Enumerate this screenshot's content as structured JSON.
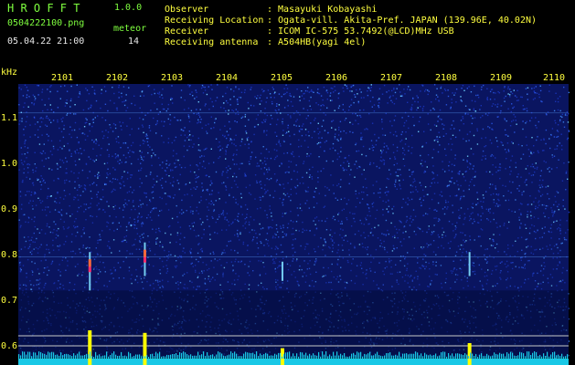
{
  "header": {
    "app_name": "H R O F F T",
    "version": "1.0.0",
    "filename": "0504222100.png",
    "meteor_label": "meteor",
    "timestamp": "05.04.22 21:00",
    "meteor_count": "14",
    "info": [
      {
        "key": "Observer",
        "value": ": Masayuki Kobayashi"
      },
      {
        "key": "Receiving Location",
        "value": ": Ogata-vill. Akita-Pref. JAPAN (139.96E, 40.02N)"
      },
      {
        "key": "Receiver",
        "value": ": ICOM IC-575 53.7492(@LCD)MHz USB"
      },
      {
        "key": "Receiving antenna",
        "value": ": A504HB(yagi 4el)"
      }
    ]
  },
  "axis": {
    "y_unit": "kHz",
    "y_ticks": [
      "1.1",
      "1.0",
      "0.9",
      "0.8",
      "0.7",
      "0.6"
    ],
    "x_ticks": [
      "2101",
      "2102",
      "2103",
      "2104",
      "2105",
      "2106",
      "2107",
      "2108",
      "2109",
      "2110"
    ]
  },
  "meteors": [
    {
      "minute": 2101.8,
      "khz_top": 0.8,
      "khz_bottom": 0.72,
      "strength": 1.0
    },
    {
      "minute": 2102.8,
      "khz_top": 0.82,
      "khz_bottom": 0.75,
      "strength": 0.9
    },
    {
      "minute": 2105.3,
      "khz_top": 0.78,
      "khz_bottom": 0.74,
      "strength": 0.3
    },
    {
      "minute": 2108.7,
      "khz_top": 0.8,
      "khz_bottom": 0.75,
      "strength": 0.5
    }
  ],
  "colors": {
    "background": "#000000",
    "spectrum_base": "#0a1a8a",
    "label_green": "#7fff3f",
    "label_yellow": "#ffff3f",
    "level_cyan": "#19c8e6",
    "peak_yellow": "#ffff00"
  }
}
